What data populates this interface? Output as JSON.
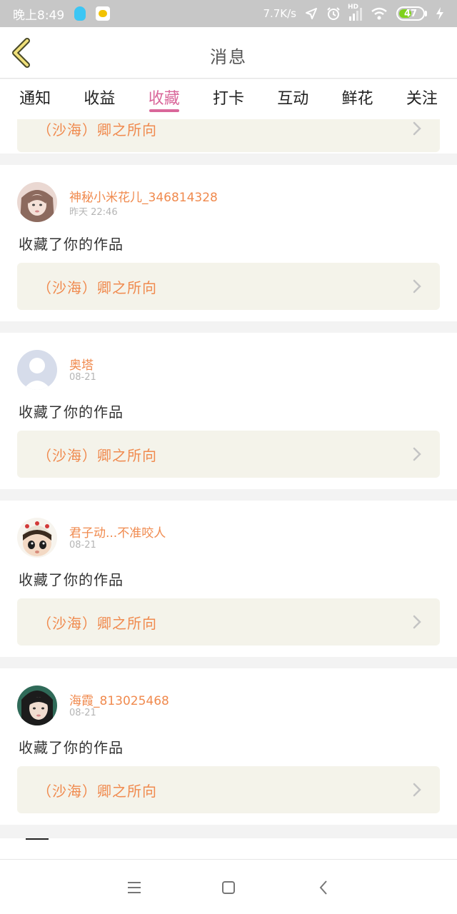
{
  "status_bar": {
    "time": "晚上8:49",
    "net_speed": "7.7K/s",
    "hd": "HD",
    "battery": "47",
    "battery_level": 0.47
  },
  "header": {
    "title": "消息"
  },
  "tabs": [
    {
      "label": "通知",
      "active": false
    },
    {
      "label": "收益",
      "active": false
    },
    {
      "label": "收藏",
      "active": true
    },
    {
      "label": "打卡",
      "active": false
    },
    {
      "label": "互动",
      "active": false
    },
    {
      "label": "鲜花",
      "active": false
    },
    {
      "label": "关注",
      "active": false
    }
  ],
  "partial_item": {
    "work_title": "（沙海）卿之所向"
  },
  "items": [
    {
      "name": "神秘小米花儿_346814328",
      "date": "昨天 22:46",
      "action": "收藏了你的作品",
      "work_title": "（沙海）卿之所向",
      "avatar": "avatar-girl-1"
    },
    {
      "name": "奥塔",
      "date": "08-21",
      "action": "收藏了你的作品",
      "work_title": "（沙海）卿之所向",
      "avatar": "avatar-default"
    },
    {
      "name": "君子动...不准咬人",
      "date": "08-21",
      "action": "收藏了你的作品",
      "work_title": "（沙海）卿之所向",
      "avatar": "avatar-doll"
    },
    {
      "name": "海霞_813025468",
      "date": "08-21",
      "action": "收藏了你的作品",
      "work_title": "（沙海）卿之所向",
      "avatar": "avatar-girl-2"
    }
  ],
  "colors": {
    "accent": "#d9679a",
    "username": "#f08a4e",
    "work_title": "#f08a4e",
    "link_bg": "#f4f3ea"
  }
}
